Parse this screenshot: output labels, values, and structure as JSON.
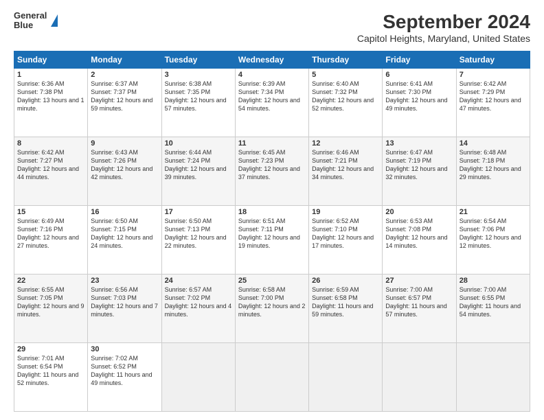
{
  "logo": {
    "line1": "General",
    "line2": "Blue"
  },
  "title": "September 2024",
  "subtitle": "Capitol Heights, Maryland, United States",
  "weekdays": [
    "Sunday",
    "Monday",
    "Tuesday",
    "Wednesday",
    "Thursday",
    "Friday",
    "Saturday"
  ],
  "weeks": [
    [
      {
        "day": "1",
        "sunrise": "6:36 AM",
        "sunset": "7:38 PM",
        "daylight": "13 hours and 1 minute."
      },
      {
        "day": "2",
        "sunrise": "6:37 AM",
        "sunset": "7:37 PM",
        "daylight": "12 hours and 59 minutes."
      },
      {
        "day": "3",
        "sunrise": "6:38 AM",
        "sunset": "7:35 PM",
        "daylight": "12 hours and 57 minutes."
      },
      {
        "day": "4",
        "sunrise": "6:39 AM",
        "sunset": "7:34 PM",
        "daylight": "12 hours and 54 minutes."
      },
      {
        "day": "5",
        "sunrise": "6:40 AM",
        "sunset": "7:32 PM",
        "daylight": "12 hours and 52 minutes."
      },
      {
        "day": "6",
        "sunrise": "6:41 AM",
        "sunset": "7:30 PM",
        "daylight": "12 hours and 49 minutes."
      },
      {
        "day": "7",
        "sunrise": "6:42 AM",
        "sunset": "7:29 PM",
        "daylight": "12 hours and 47 minutes."
      }
    ],
    [
      {
        "day": "8",
        "sunrise": "6:42 AM",
        "sunset": "7:27 PM",
        "daylight": "12 hours and 44 minutes."
      },
      {
        "day": "9",
        "sunrise": "6:43 AM",
        "sunset": "7:26 PM",
        "daylight": "12 hours and 42 minutes."
      },
      {
        "day": "10",
        "sunrise": "6:44 AM",
        "sunset": "7:24 PM",
        "daylight": "12 hours and 39 minutes."
      },
      {
        "day": "11",
        "sunrise": "6:45 AM",
        "sunset": "7:23 PM",
        "daylight": "12 hours and 37 minutes."
      },
      {
        "day": "12",
        "sunrise": "6:46 AM",
        "sunset": "7:21 PM",
        "daylight": "12 hours and 34 minutes."
      },
      {
        "day": "13",
        "sunrise": "6:47 AM",
        "sunset": "7:19 PM",
        "daylight": "12 hours and 32 minutes."
      },
      {
        "day": "14",
        "sunrise": "6:48 AM",
        "sunset": "7:18 PM",
        "daylight": "12 hours and 29 minutes."
      }
    ],
    [
      {
        "day": "15",
        "sunrise": "6:49 AM",
        "sunset": "7:16 PM",
        "daylight": "12 hours and 27 minutes."
      },
      {
        "day": "16",
        "sunrise": "6:50 AM",
        "sunset": "7:15 PM",
        "daylight": "12 hours and 24 minutes."
      },
      {
        "day": "17",
        "sunrise": "6:50 AM",
        "sunset": "7:13 PM",
        "daylight": "12 hours and 22 minutes."
      },
      {
        "day": "18",
        "sunrise": "6:51 AM",
        "sunset": "7:11 PM",
        "daylight": "12 hours and 19 minutes."
      },
      {
        "day": "19",
        "sunrise": "6:52 AM",
        "sunset": "7:10 PM",
        "daylight": "12 hours and 17 minutes."
      },
      {
        "day": "20",
        "sunrise": "6:53 AM",
        "sunset": "7:08 PM",
        "daylight": "12 hours and 14 minutes."
      },
      {
        "day": "21",
        "sunrise": "6:54 AM",
        "sunset": "7:06 PM",
        "daylight": "12 hours and 12 minutes."
      }
    ],
    [
      {
        "day": "22",
        "sunrise": "6:55 AM",
        "sunset": "7:05 PM",
        "daylight": "12 hours and 9 minutes."
      },
      {
        "day": "23",
        "sunrise": "6:56 AM",
        "sunset": "7:03 PM",
        "daylight": "12 hours and 7 minutes."
      },
      {
        "day": "24",
        "sunrise": "6:57 AM",
        "sunset": "7:02 PM",
        "daylight": "12 hours and 4 minutes."
      },
      {
        "day": "25",
        "sunrise": "6:58 AM",
        "sunset": "7:00 PM",
        "daylight": "12 hours and 2 minutes."
      },
      {
        "day": "26",
        "sunrise": "6:59 AM",
        "sunset": "6:58 PM",
        "daylight": "11 hours and 59 minutes."
      },
      {
        "day": "27",
        "sunrise": "7:00 AM",
        "sunset": "6:57 PM",
        "daylight": "11 hours and 57 minutes."
      },
      {
        "day": "28",
        "sunrise": "7:00 AM",
        "sunset": "6:55 PM",
        "daylight": "11 hours and 54 minutes."
      }
    ],
    [
      {
        "day": "29",
        "sunrise": "7:01 AM",
        "sunset": "6:54 PM",
        "daylight": "11 hours and 52 minutes."
      },
      {
        "day": "30",
        "sunrise": "7:02 AM",
        "sunset": "6:52 PM",
        "daylight": "11 hours and 49 minutes."
      },
      null,
      null,
      null,
      null,
      null
    ]
  ]
}
